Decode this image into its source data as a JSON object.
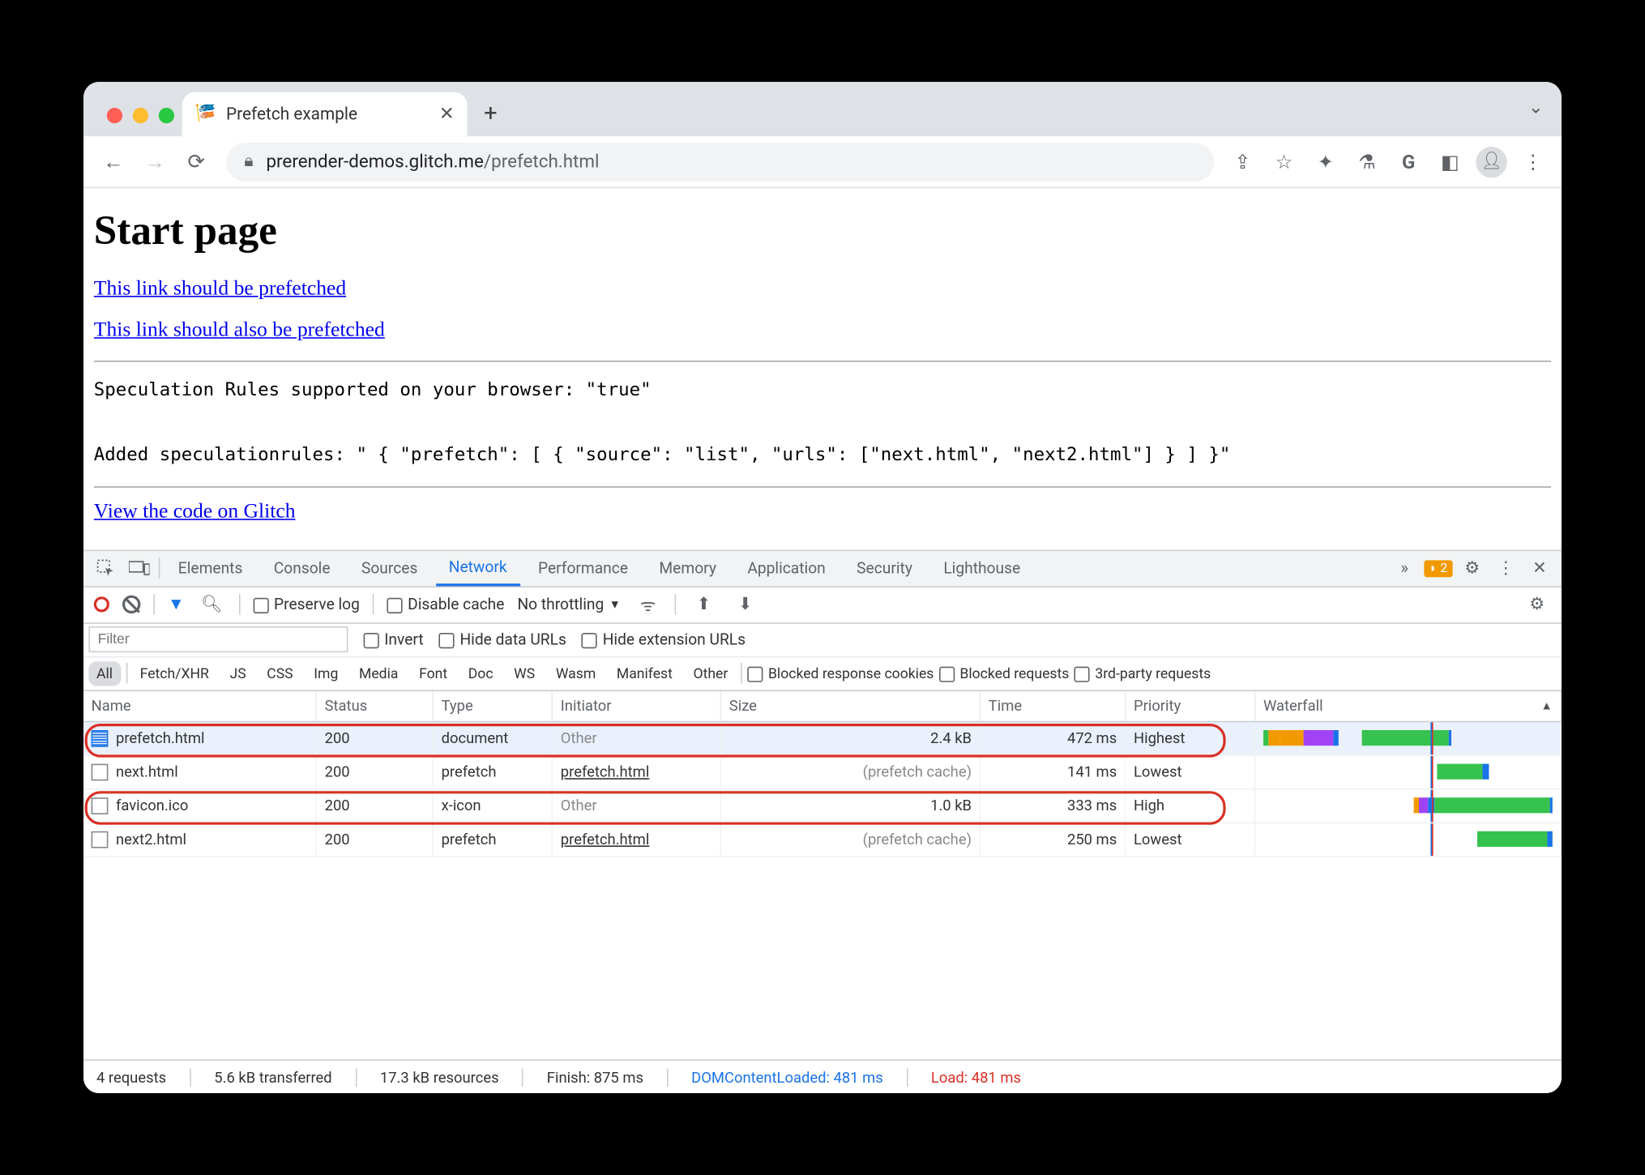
{
  "tab": {
    "title": "Prefetch example"
  },
  "address": {
    "url_host": "prerender-demos.glitch.me",
    "url_path": "/prefetch.html"
  },
  "page": {
    "heading": "Start page",
    "link1": "This link should be prefetched",
    "link2": "This link should also be prefetched",
    "code_line1": "Speculation Rules supported on your browser: \"true\"",
    "code_line2": "Added speculationrules: \" { \"prefetch\": [ { \"source\": \"list\", \"urls\": [\"next.html\", \"next2.html\"] } ] }\"",
    "link3": "View the code on Glitch"
  },
  "devtools": {
    "tabs": [
      "Elements",
      "Console",
      "Sources",
      "Network",
      "Performance",
      "Memory",
      "Application",
      "Security",
      "Lighthouse"
    ],
    "active_tab": "Network",
    "warn_count": "2",
    "toolbar": {
      "preserve_log": "Preserve log",
      "disable_cache": "Disable cache",
      "throttling": "No throttling"
    },
    "filter": {
      "placeholder": "Filter",
      "invert": "Invert",
      "hide_data": "Hide data URLs",
      "hide_ext": "Hide extension URLs"
    },
    "types": [
      "All",
      "Fetch/XHR",
      "JS",
      "CSS",
      "Img",
      "Media",
      "Font",
      "Doc",
      "WS",
      "Wasm",
      "Manifest",
      "Other"
    ],
    "type_checks": {
      "brc": "Blocked response cookies",
      "br": "Blocked requests",
      "tp": "3rd-party requests"
    },
    "columns": [
      "Name",
      "Status",
      "Type",
      "Initiator",
      "Size",
      "Time",
      "Priority",
      "Waterfall"
    ],
    "rows": [
      {
        "name": "prefetch.html",
        "status": "200",
        "type": "document",
        "initiator": "Other",
        "initiator_link": false,
        "size": "2.4 kB",
        "size_muted": false,
        "time": "472 ms",
        "priority": "Highest",
        "icon": "doc",
        "sel": true
      },
      {
        "name": "next.html",
        "status": "200",
        "type": "prefetch",
        "initiator": "prefetch.html",
        "initiator_link": true,
        "size": "(prefetch cache)",
        "size_muted": true,
        "time": "141 ms",
        "priority": "Lowest",
        "icon": "box",
        "sel": false
      },
      {
        "name": "favicon.ico",
        "status": "200",
        "type": "x-icon",
        "initiator": "Other",
        "initiator_link": false,
        "size": "1.0 kB",
        "size_muted": false,
        "time": "333 ms",
        "priority": "High",
        "icon": "box",
        "sel": false
      },
      {
        "name": "next2.html",
        "status": "200",
        "type": "prefetch",
        "initiator": "prefetch.html",
        "initiator_link": true,
        "size": "(prefetch cache)",
        "size_muted": true,
        "time": "250 ms",
        "priority": "Lowest",
        "icon": "box",
        "sel": false
      }
    ],
    "status": {
      "requests": "4 requests",
      "transferred": "5.6 kB transferred",
      "resources": "17.3 kB resources",
      "finish": "Finish: 875 ms",
      "dcl": "DOMContentLoaded: 481 ms",
      "load": "Load: 481 ms"
    }
  }
}
